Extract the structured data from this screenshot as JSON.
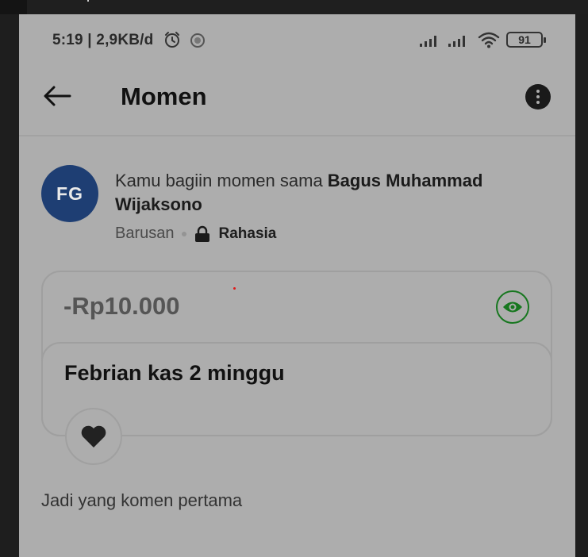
{
  "status_bar": {
    "time": "5:19 | 2,9KB/d",
    "battery": "91",
    "icons": [
      "alarm-icon",
      "camera-icon",
      "signal-icon",
      "signal-icon",
      "wifi-icon",
      "battery-icon"
    ]
  },
  "app_bar": {
    "title": "Momen",
    "back_icon": "arrow-left-icon",
    "more_icon": "more-vertical-icon"
  },
  "post": {
    "avatar_initials": "FG",
    "avatar_color": "#1e3e73",
    "text_prefix": "Kamu bagiin momen sama ",
    "text_name": "Bagus Muhammad Wijaksono",
    "time": "Barusan",
    "privacy": "Rahasia",
    "amount": "-Rp10.000",
    "note": "Febrian kas 2 minggu"
  },
  "comments": {
    "empty_prompt": "Jadi yang komen pertama"
  },
  "colors": {
    "background": "#adadad",
    "accent_green": "#17771f",
    "avatar_blue": "#1e3e73"
  }
}
